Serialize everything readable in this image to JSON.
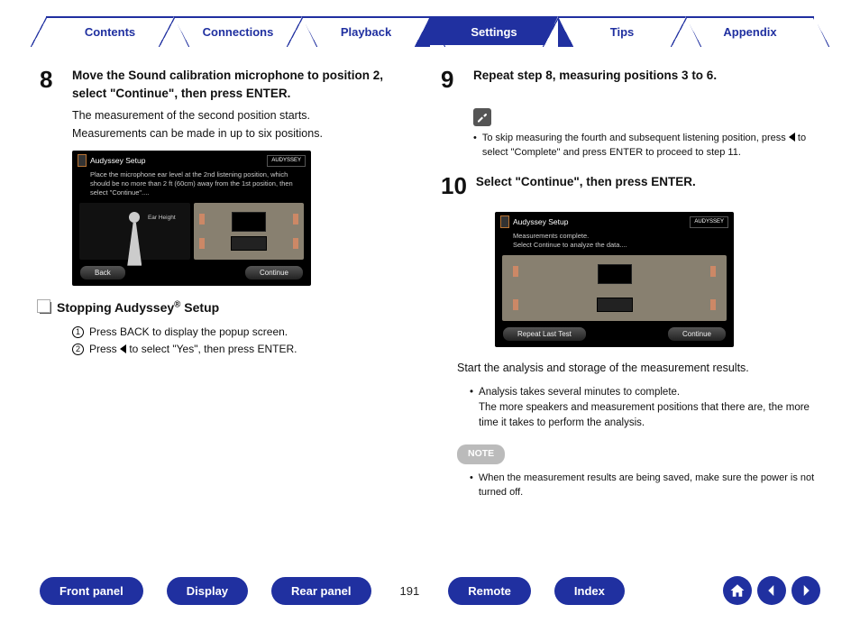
{
  "tabs": [
    "Contents",
    "Connections",
    "Playback",
    "Settings",
    "Tips",
    "Appendix"
  ],
  "active_tab": 3,
  "left": {
    "step8": {
      "num": "8",
      "title": "Move the Sound calibration microphone to position 2, select \"Continue\", then press ENTER.",
      "body1": "The measurement of the second position starts.",
      "body2": "Measurements can be made in up to six positions."
    },
    "aud1": {
      "title": "Audyssey Setup",
      "brand": "AUDYSSEY",
      "text": "Place the microphone ear level at the 2nd listening position, which should be no more than 2 ft (60cm) away from the 1st position, then select \"Continue\"....",
      "ear": "Ear Height",
      "back": "Back",
      "cont": "Continue"
    },
    "stop": {
      "heading": "Stopping Audyssey",
      "heading_suffix": " Setup",
      "li1": "Press BACK to display the popup screen.",
      "li2_a": "Press ",
      "li2_b": " to select \"Yes\", then press ENTER."
    }
  },
  "right": {
    "step9": {
      "num": "9",
      "title": "Repeat step 8, measuring positions 3 to 6.",
      "tip_a": "To skip measuring the fourth and subsequent listening position, press ",
      "tip_b": " to select \"Complete\" and press ENTER to proceed to step 11."
    },
    "step10": {
      "num": "10",
      "title": "Select \"Continue\", then press ENTER."
    },
    "aud2": {
      "title": "Audyssey Setup",
      "brand": "AUDYSSEY",
      "text1": "Measurements complete.",
      "text2": "Select Continue to analyze the data....",
      "repeat": "Repeat Last Test",
      "cont": "Continue"
    },
    "analysis": {
      "p1": "Start the analysis and storage of the measurement results.",
      "b1": "Analysis takes several minutes to complete.",
      "b2": "The more speakers and measurement positions that there are, the more time it takes to perform the analysis."
    },
    "note": {
      "label": "NOTE",
      "text": "When the measurement results are being saved, make sure the power is not turned off."
    }
  },
  "footer": {
    "buttons": [
      "Front panel",
      "Display",
      "Rear panel"
    ],
    "page": "191",
    "buttons2": [
      "Remote",
      "Index"
    ]
  }
}
